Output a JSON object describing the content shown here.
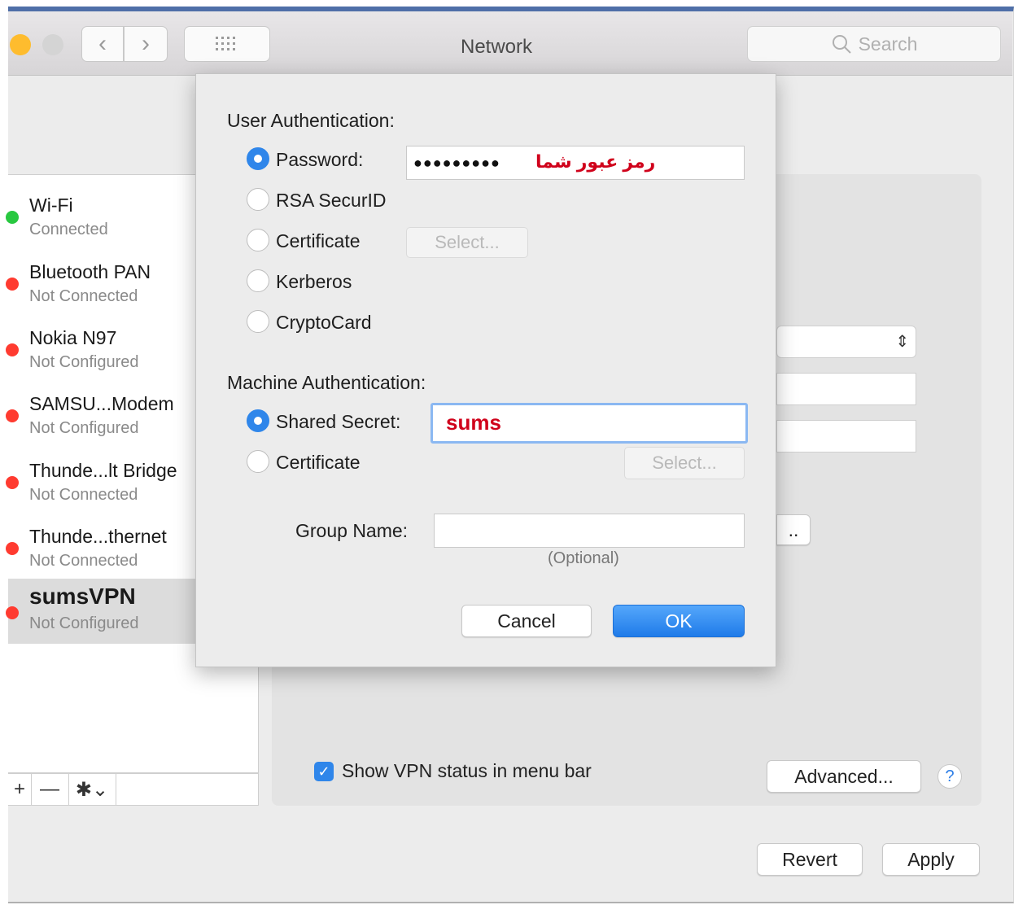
{
  "window": {
    "title": "Network",
    "search_placeholder": "Search",
    "colors": {
      "close": "#ff5f57",
      "minimize": "#febc2e",
      "accent": "#2f86ea"
    }
  },
  "toolbar": {
    "back_icon": "chevron-left-icon",
    "forward_icon": "chevron-right-icon",
    "grid_icon": "grid-icon"
  },
  "sidebar": {
    "services": [
      {
        "name": "Wi-Fi",
        "status": "Connected",
        "color": "#28c840"
      },
      {
        "name": "Bluetooth PAN",
        "status": "Not Connected",
        "color": "#ff3b30"
      },
      {
        "name": "Nokia N97",
        "status": "Not Configured",
        "color": "#ff3b30"
      },
      {
        "name": "SAMSU...Modem",
        "status": "Not Configured",
        "color": "#ff3b30"
      },
      {
        "name": "Thunde...lt Bridge",
        "status": "Not Connected",
        "color": "#ff3b30"
      },
      {
        "name": "Thunde...thernet",
        "status": "Not Connected",
        "color": "#ff3b30"
      },
      {
        "name": "sumsVPN",
        "status": "Not Configured",
        "color": "#ff3b30",
        "selected": true
      }
    ],
    "tools": {
      "add": "+",
      "remove": "—",
      "gear": "✱⌄"
    }
  },
  "panel": {
    "show_vpn_status": "Show VPN status in menu bar",
    "show_vpn_checked": true,
    "advanced": "Advanced...",
    "help": "?",
    "partial_button": "..",
    "revert": "Revert",
    "apply": "Apply"
  },
  "sheet": {
    "user_auth_heading": "User Authentication:",
    "user_options": [
      {
        "label": "Password:",
        "selected": true
      },
      {
        "label": "RSA SecurID",
        "selected": false
      },
      {
        "label": "Certificate",
        "selected": false
      },
      {
        "label": "Kerberos",
        "selected": false
      },
      {
        "label": "CryptoCard",
        "selected": false
      }
    ],
    "password_dots": "●●●●●●●●●",
    "password_note": "رمز عبور شما",
    "cert_select": "Select...",
    "machine_auth_heading": "Machine Authentication:",
    "machine_options": [
      {
        "label": "Shared Secret:",
        "selected": true
      },
      {
        "label": "Certificate",
        "selected": false
      }
    ],
    "shared_secret_value": "sums",
    "machine_cert_select": "Select...",
    "group_name_label": "Group Name:",
    "group_name_value": "",
    "optional_hint": "(Optional)",
    "cancel": "Cancel",
    "ok": "OK"
  }
}
